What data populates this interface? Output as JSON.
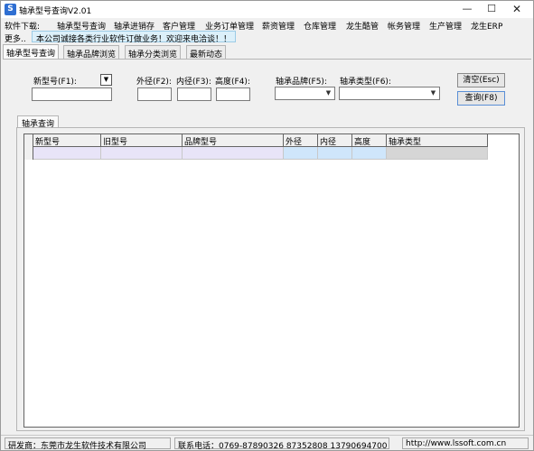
{
  "window": {
    "title": "轴承型号查询V2.01",
    "minimize": "—",
    "maximize": "☐",
    "close": "✕"
  },
  "menu": {
    "label": "软件下载:",
    "items": [
      "轴承型号查询",
      "轴承进销存",
      "客户管理",
      "业务订单管理",
      "薪资管理",
      "仓库管理",
      "龙生酷管",
      "帐务管理",
      "生产管理",
      "龙生ERP"
    ],
    "more": "更多..",
    "notice": "本公司诚接各类行业软件订做业务！欢迎来电洽谈！！"
  },
  "tabs": [
    "轴承型号查询",
    "轴承品牌浏览",
    "轴承分类浏览",
    "最新动态"
  ],
  "search": {
    "new_model_label": "新型号(F1):",
    "outer_label": "外径(F2):",
    "inner_label": "内径(F3):",
    "height_label": "高度(F4):",
    "brand_label": "轴承品牌(F5):",
    "type_label": "轴承类型(F6):",
    "clear_button": "清空(Esc)",
    "query_button": "查询(F8)"
  },
  "results": {
    "tab_label": "轴承查询",
    "columns": [
      "新型号",
      "旧型号",
      "品牌型号",
      "外径",
      "内径",
      "高度",
      "轴承类型"
    ]
  },
  "status": {
    "developer": "研发商：东莞市龙生软件技术有限公司",
    "phone": "联系电话：0769-87890326 87352808 13790694700",
    "website": "http://www.lssoft.com.cn"
  },
  "colors": {
    "cell_default": "#e8e4f8",
    "cell_numeric": "#cfe6fb",
    "cell_type": "#d6d6d6"
  }
}
